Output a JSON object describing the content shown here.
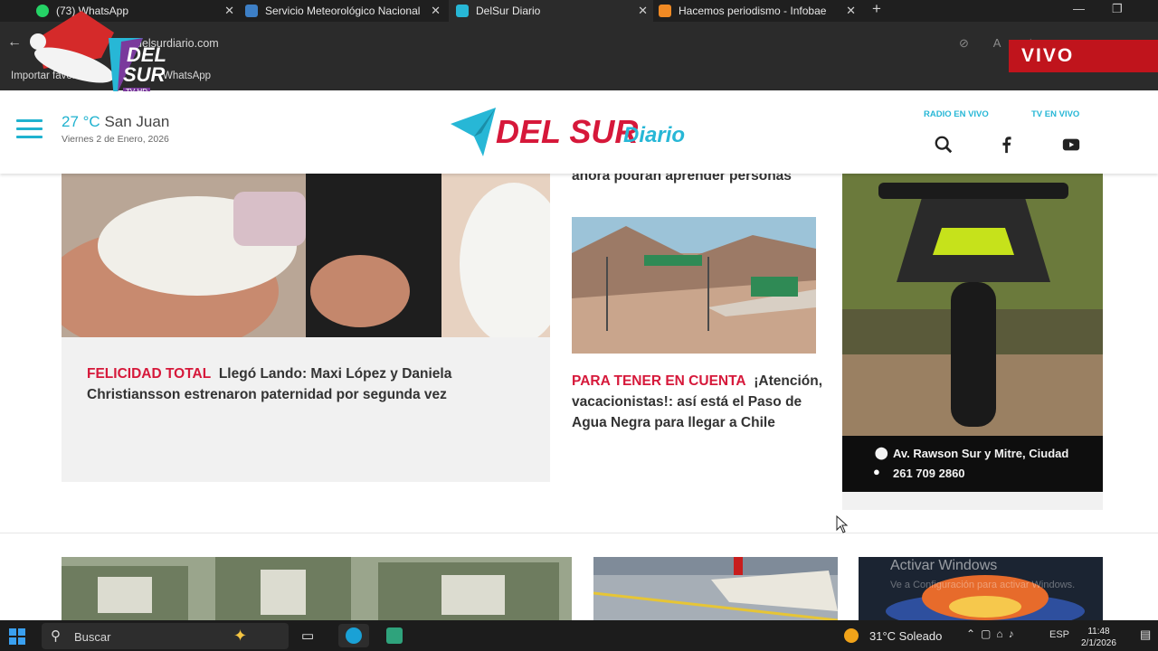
{
  "browser": {
    "tabs": [
      {
        "title": "(73) WhatsApp",
        "favicon_color": "#25d366",
        "active": false
      },
      {
        "title": "Servicio Meteorológico Nacional",
        "favicon_color": "#3d7fc6",
        "active": false
      },
      {
        "title": "DelSur Diario",
        "favicon_color": "#27b7d6",
        "active": true
      },
      {
        "title": "Hacemos periodismo - Infobae",
        "favicon_color": "#f08a24",
        "active": false
      }
    ],
    "url": "delsurdiario.com",
    "bookmarks": [
      "Importar favoritos",
      "WhatsApp"
    ]
  },
  "overlay": {
    "live_label": "VIVO",
    "channel_logo_text": [
      "DEL",
      "SUR"
    ],
    "channel_logo_sub": "TV HD"
  },
  "site_header": {
    "temperature": "27 °C",
    "city": "San Juan",
    "date": "Viernes 2 de Enero, 2026",
    "logo_main": "DEL SUR",
    "logo_sub": "Diario",
    "radio_link": "RADIO EN VIVO",
    "tv_link": "TV EN VIVO",
    "accent_color": "#27b7d6",
    "brand_red": "#d6183a"
  },
  "articles": [
    {
      "kicker": "FELICIDAD TOTAL",
      "title": "Llegó Lando: Maxi López y Daniela Christiansson estrenaron paternidad por segunda vez"
    },
    {
      "kicker": "PARA TENER EN CUENTA",
      "title": "¡Atención, vacacionistas!: así está el Paso de Agua Negra para llegar a Chile"
    }
  ],
  "cut_headline": "ahora podrán aprender personas",
  "ad": {
    "address": "Av. Rawson Sur y Mitre, Ciudad",
    "phone": "261 709 2860"
  },
  "watermark": {
    "line1": "Activar Windows",
    "line2": "Ve a Configuración para activar Windows."
  },
  "taskbar": {
    "search_label": "Buscar",
    "weather": "31°C  Soleado",
    "lang": "ESP",
    "time": "11:48",
    "date": "2/1/2026"
  }
}
